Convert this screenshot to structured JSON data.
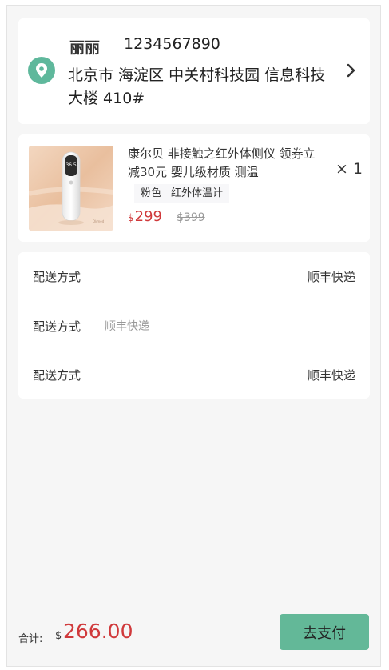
{
  "address": {
    "name": "丽丽",
    "phone": "1234567890",
    "full_address": "北京市 海淀区 中关村科技园 信息科技大楼 410#",
    "icons": {
      "location": "location-pin-icon",
      "arrow": "chevron-right-icon"
    }
  },
  "product": {
    "title": "康尔贝 非接触之红外体侧仪 领券立减30元 婴儿级材质 测温",
    "spec_color": "粉色",
    "spec_type": "红外体温计",
    "currency": "$",
    "price": "299",
    "original_price": "$399",
    "quantity": "× 1"
  },
  "shipping": {
    "rows": [
      {
        "label": "配送方式",
        "value": "顺丰快递"
      },
      {
        "label": "配送方式",
        "value": "顺丰快递"
      },
      {
        "label": "配送方式",
        "value": "顺丰快递"
      }
    ]
  },
  "footer": {
    "total_label": "合计:",
    "currency": "$",
    "total_amount": "266.00",
    "pay_button": "去支付"
  },
  "colors": {
    "accent": "#63b898",
    "price": "#d0393b"
  }
}
